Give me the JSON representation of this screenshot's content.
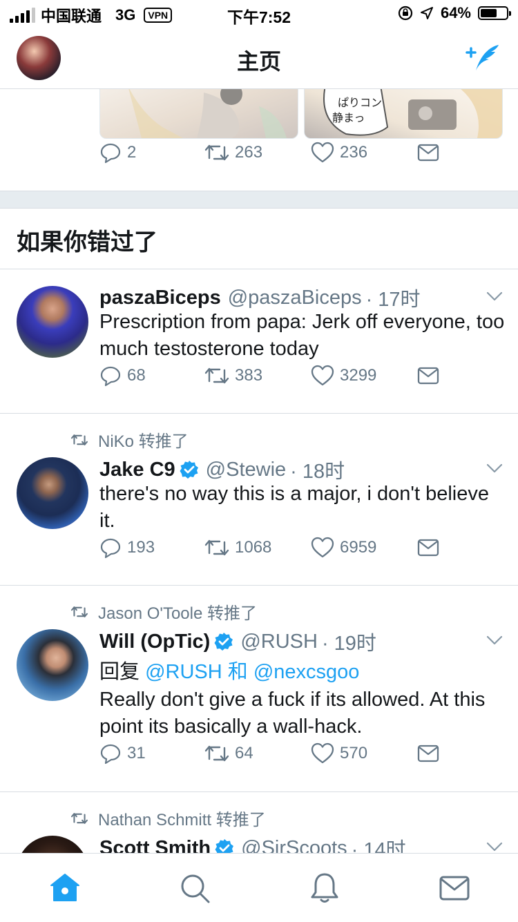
{
  "status_bar": {
    "carrier": "中国联通",
    "network": "3G",
    "vpn": "VPN",
    "time": "下午7:52",
    "battery": "64%",
    "battery_level": 0.64
  },
  "nav": {
    "title": "主页"
  },
  "top_tweet": {
    "reply_count": "2",
    "retweet_count": "263",
    "like_count": "236"
  },
  "section": {
    "title": "如果你错过了"
  },
  "tweets": [
    {
      "retweeted_by": "",
      "name": "paszaBiceps",
      "handle": "@paszaBiceps",
      "time": "· 17时",
      "text": "Prescription from papa: Jerk off everyone, too much testosterone today",
      "reply_count": "68",
      "retweet_count": "383",
      "like_count": "3299"
    },
    {
      "retweeted_by": "NiKo 转推了",
      "name": "Jake C9",
      "handle": "@Stewie",
      "time": "· 18时",
      "text": "there's no way this is a major, i don't believe it.",
      "reply_count": "193",
      "retweet_count": "1068",
      "like_count": "6959"
    },
    {
      "retweeted_by": "Jason O'Toole 转推了",
      "name": "Will (OpTic)",
      "handle": "@RUSH",
      "time": "· 19时",
      "reply_prefix": "回复",
      "reply_user1": "@RUSH",
      "reply_and": "和",
      "reply_user2": "@nexcsgoo",
      "text": "Really don't give a fuck if its allowed. At this point its basically a wall-hack.",
      "reply_count": "31",
      "retweet_count": "64",
      "like_count": "570"
    },
    {
      "retweeted_by": "Nathan Schmitt 转推了",
      "name": "Scott Smith",
      "handle": "@SirScoots",
      "time": "· 14时"
    }
  ],
  "tab_bar": {
    "items": [
      "home-icon",
      "search-icon",
      "notifications-icon",
      "messages-icon"
    ],
    "active": "home-icon"
  },
  "colors": {
    "accent": "#1da1f2",
    "muted": "#657786",
    "text": "#14171a",
    "divider": "#e6ecf0"
  }
}
